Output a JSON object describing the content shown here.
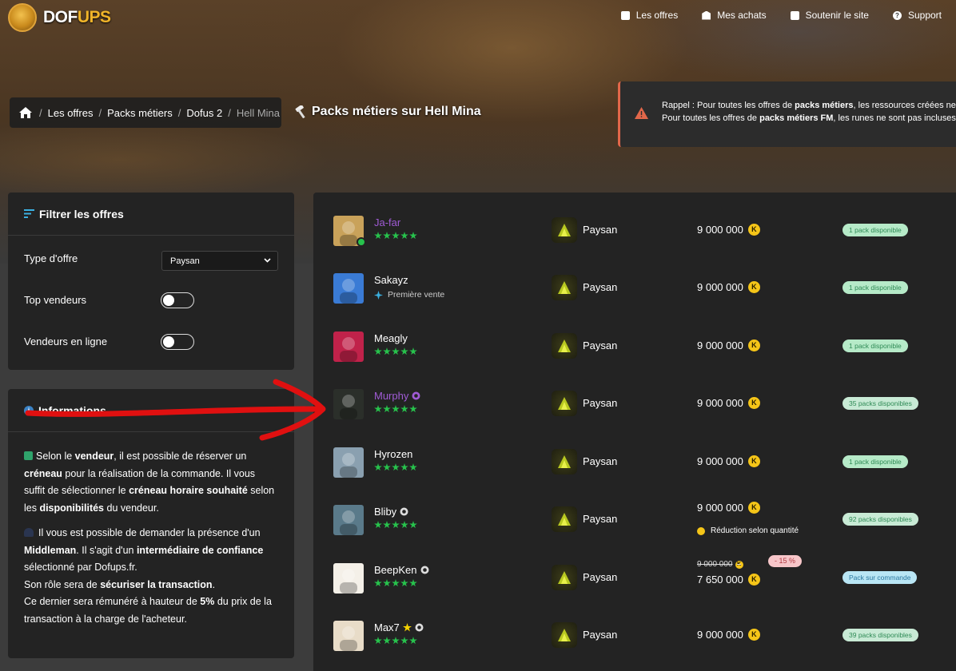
{
  "site": {
    "logo_main": "DOF",
    "logo_accent": "UPS"
  },
  "nav": [
    {
      "label": "Les offres",
      "icon": "bag-icon"
    },
    {
      "label": "Mes achats",
      "icon": "box-icon"
    },
    {
      "label": "Soutenir le site",
      "icon": "heart-icon"
    },
    {
      "label": "Support",
      "icon": "help-icon"
    }
  ],
  "breadcrumb": {
    "items": [
      "Les offres",
      "Packs métiers",
      "Dofus 2"
    ],
    "current": "Hell Mina"
  },
  "page_title": "Packs métiers sur Hell Mina",
  "alert": {
    "line1_prefix": "Rappel : Pour toutes les offres de ",
    "line1_bold": "packs métiers",
    "line1_suffix": ", les ressources créées ne",
    "line2_prefix": "Pour toutes les offres de ",
    "line2_bold": "packs métiers FM",
    "line2_suffix": ", les runes ne sont pas incluses"
  },
  "filter": {
    "title": "Filtrer les offres",
    "offer_type_label": "Type d'offre",
    "offer_type_value": "Paysan",
    "top_sellers_label": "Top vendeurs",
    "online_sellers_label": "Vendeurs en ligne",
    "top_sellers_on": false,
    "online_sellers_on": false
  },
  "info": {
    "title": "Informations",
    "p1": [
      {
        "t": "Selon le ",
        "b": false
      },
      {
        "t": "vendeur",
        "b": true
      },
      {
        "t": ", il est possible de réserver un ",
        "b": false
      },
      {
        "t": "créneau",
        "b": true
      },
      {
        "t": " pour la réalisation de la commande. Il vous suffit de sélectionner le ",
        "b": false
      },
      {
        "t": "créneau horaire souhaité",
        "b": true
      },
      {
        "t": " selon les ",
        "b": false
      },
      {
        "t": "disponibilités",
        "b": true
      },
      {
        "t": " du vendeur.",
        "b": false
      }
    ],
    "p2": [
      {
        "t": "Il vous est possible de demander la présence d'un ",
        "b": false
      },
      {
        "t": "Middleman",
        "b": true
      },
      {
        "t": ". Il s'agit d'un ",
        "b": false
      },
      {
        "t": "intermédiaire de confiance",
        "b": true
      },
      {
        "t": " sélectionné par Dofups.fr.",
        "b": false
      }
    ],
    "p3": [
      {
        "t": "Son rôle sera de ",
        "b": false
      },
      {
        "t": "sécuriser la transaction",
        "b": true
      },
      {
        "t": ".",
        "b": false
      }
    ],
    "p4": [
      {
        "t": "Ce dernier sera rémunéré à hauteur de ",
        "b": false
      },
      {
        "t": "5%",
        "b": true
      },
      {
        "t": " du prix de la transaction à la charge de l'acheteur.",
        "b": false
      }
    ]
  },
  "offers": [
    {
      "seller": "Ja-far",
      "purple": true,
      "online": true,
      "badges": [],
      "rating": 5,
      "first_sale": null,
      "job": "Paysan",
      "price": "9 000 000",
      "old_price": null,
      "discount": null,
      "qty_note": null,
      "availability": "1 pack disponible",
      "avail_type": "single",
      "avatar_color": "#c9a25a"
    },
    {
      "seller": "Sakayz",
      "purple": false,
      "online": false,
      "badges": [],
      "rating": null,
      "first_sale": "Première vente",
      "job": "Paysan",
      "price": "9 000 000",
      "old_price": null,
      "discount": null,
      "qty_note": null,
      "availability": "1 pack disponible",
      "avail_type": "single",
      "avatar_color": "#3a7bd5"
    },
    {
      "seller": "Meagly",
      "purple": false,
      "online": false,
      "badges": [],
      "rating": 5,
      "first_sale": null,
      "job": "Paysan",
      "price": "9 000 000",
      "old_price": null,
      "discount": null,
      "qty_note": null,
      "availability": "1 pack disponible",
      "avail_type": "single",
      "avatar_color": "#c0224a"
    },
    {
      "seller": "Murphy",
      "purple": true,
      "online": false,
      "badges": [
        "medal-icon"
      ],
      "rating": 5,
      "first_sale": null,
      "job": "Paysan",
      "price": "9 000 000",
      "old_price": null,
      "discount": null,
      "qty_note": null,
      "availability": "35 packs disponibles",
      "avail_type": "multi",
      "avatar_color": "#2b2f2a"
    },
    {
      "seller": "Hyrozen",
      "purple": false,
      "online": false,
      "badges": [],
      "rating": 5,
      "first_sale": null,
      "job": "Paysan",
      "price": "9 000 000",
      "old_price": null,
      "discount": null,
      "qty_note": null,
      "availability": "1 pack disponible",
      "avail_type": "single",
      "avatar_color": "#8aa0b0"
    },
    {
      "seller": "Bliby",
      "purple": false,
      "online": false,
      "badges": [
        "medal-icon"
      ],
      "rating": 5,
      "first_sale": null,
      "job": "Paysan",
      "price": "9 000 000",
      "old_price": null,
      "discount": null,
      "qty_note": "Réduction selon quantité",
      "availability": "92 packs disponibles",
      "avail_type": "multi",
      "avatar_color": "#5a7a8a"
    },
    {
      "seller": "BeepKen",
      "purple": false,
      "online": false,
      "badges": [
        "medal-icon"
      ],
      "rating": 5,
      "first_sale": null,
      "job": "Paysan",
      "price": "7 650 000",
      "old_price": "9 000 000",
      "discount": "- 15 %",
      "qty_note": null,
      "availability": "Pack sur commande",
      "avail_type": "order",
      "avatar_color": "#f4f0e8"
    },
    {
      "seller": "Max7",
      "purple": false,
      "online": false,
      "badges": [
        "star-badge-icon",
        "medal-icon"
      ],
      "rating": 5,
      "first_sale": null,
      "job": "Paysan",
      "price": "9 000 000",
      "old_price": null,
      "discount": null,
      "qty_note": null,
      "availability": "39 packs disponibles",
      "avail_type": "multi",
      "avatar_color": "#e8dcc8"
    }
  ],
  "colors": {
    "star_green": "#27c24c",
    "seller_purple": "#a05bd5",
    "kama_gold": "#f5c518",
    "alert_border": "#e2674a"
  }
}
